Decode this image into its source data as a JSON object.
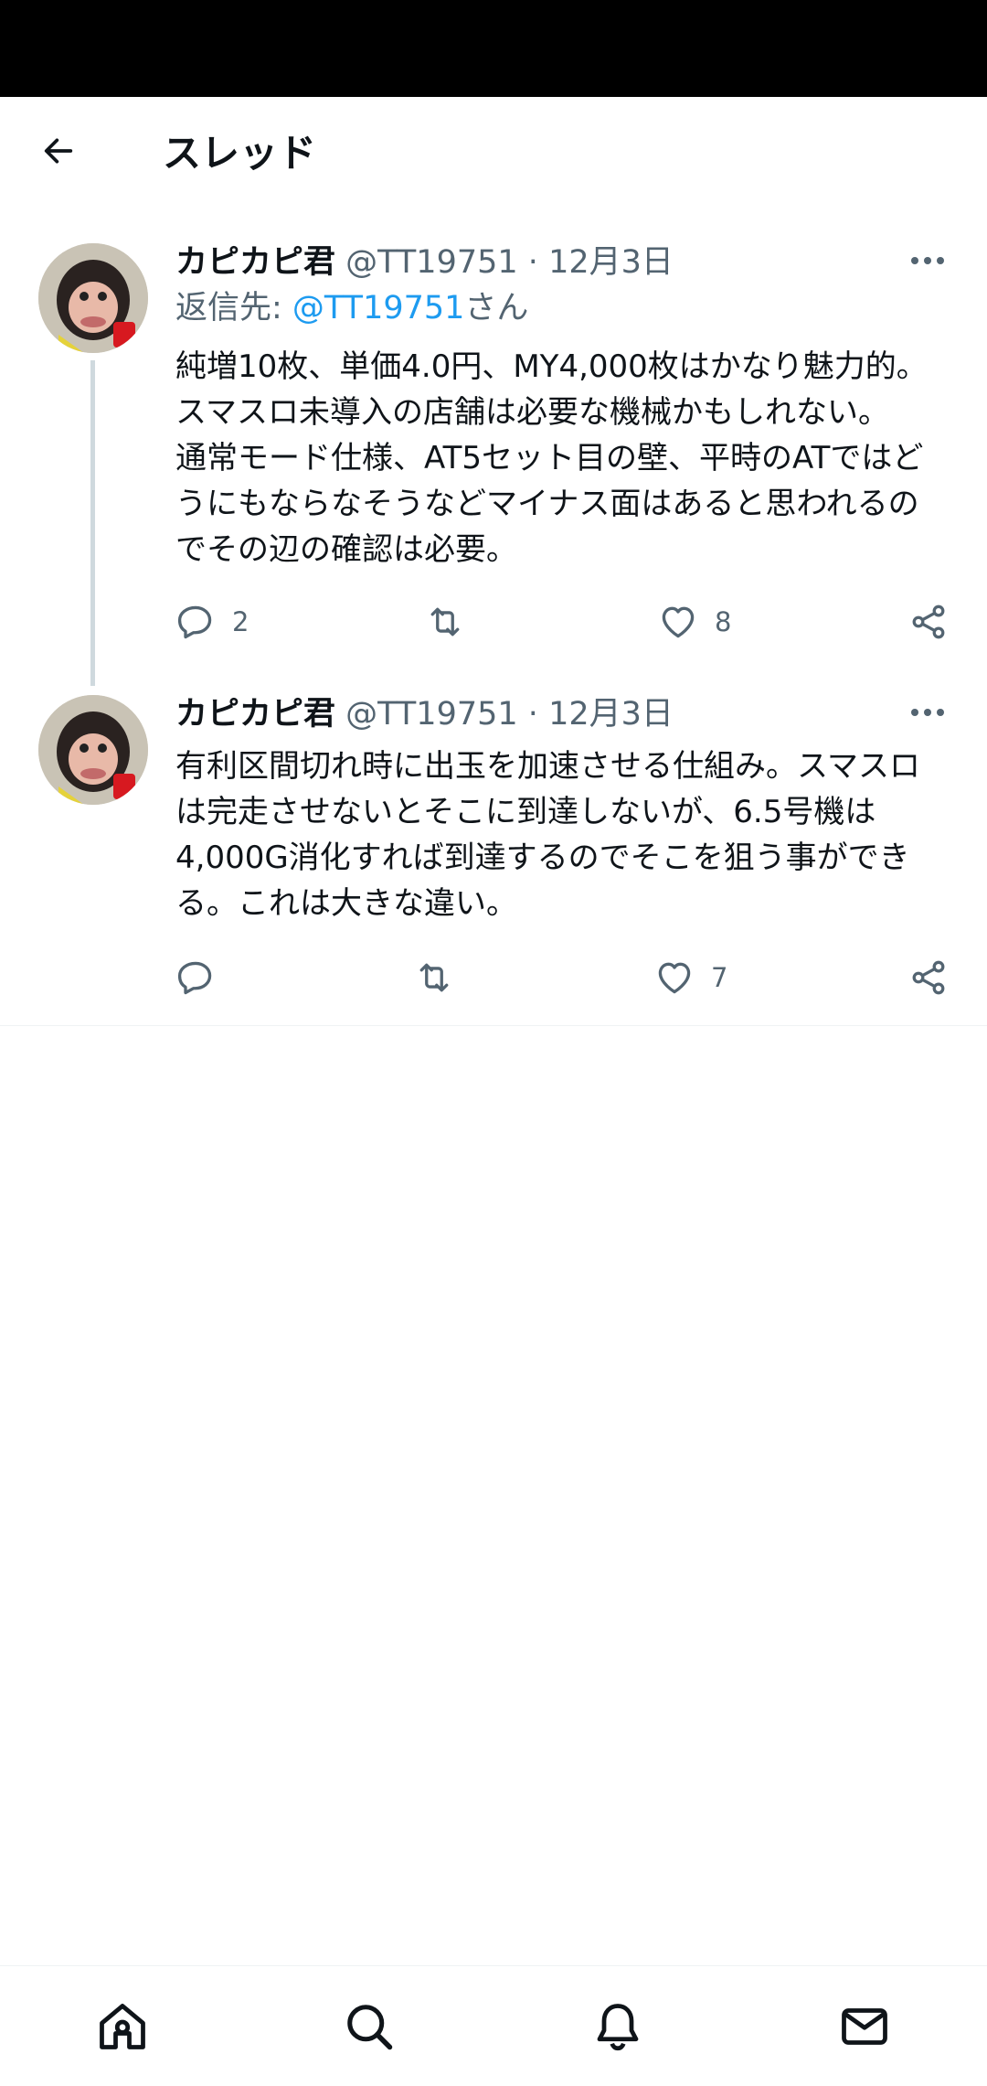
{
  "header": {
    "title": "スレッド"
  },
  "tweets": [
    {
      "name": "カピカピ君",
      "handle": "@TT19751",
      "separator": "·",
      "date": "12月3日",
      "reply_prefix": "返信先: ",
      "reply_mention": "@TT19751",
      "reply_suffix": "さん",
      "lines": [
        "純増10枚、単価4.0円、MY4,000枚はかなり魅力的。",
        "スマスロ未導入の店舗は必要な機械かもしれない。",
        "通常モード仕様、AT5セット目の壁、平時のATではど",
        "うにもならなそうなどマイナス面はあると思われるの",
        "でその辺の確認は必要。"
      ],
      "reply_count": "2",
      "like_count": "8"
    },
    {
      "name": "カピカピ君",
      "handle": "@TT19751",
      "separator": "·",
      "date": "12月3日",
      "lines": [
        "有利区間切れ時に出玉を加速させる仕組み。スマスロ",
        "は完走させないとそこに到達しないが、6.5号機は",
        "4,000G消化すれば到達するのでそこを狙う事ができ",
        "る。これは大きな違い。"
      ],
      "like_count": "7"
    }
  ],
  "icons": {
    "back": "arrow-left-icon",
    "more": "more-horizontal-icon",
    "reply": "reply-icon",
    "retweet": "retweet-icon",
    "like": "heart-icon",
    "share": "share-icon",
    "home": "home-icon",
    "search": "search-icon",
    "notifications": "bell-icon",
    "messages": "envelope-icon"
  },
  "colors": {
    "text": "#0f1419",
    "secondary": "#536471",
    "link": "#1d9bf0",
    "thread_line": "#cfd9de"
  }
}
